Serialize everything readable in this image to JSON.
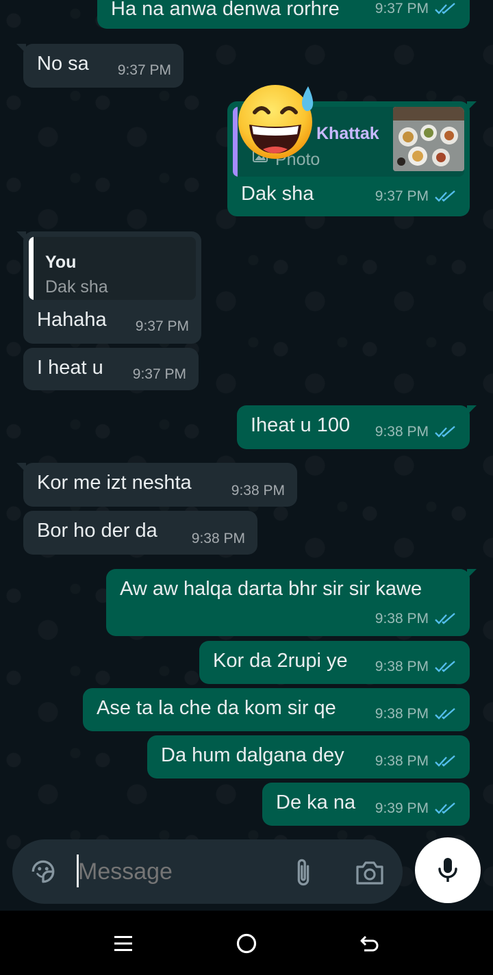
{
  "messages": [
    {
      "direction": "out",
      "text": "Ha na anwa denwa rorhre",
      "time": "9:37 PM"
    },
    {
      "direction": "in",
      "text": "No sa",
      "time": "9:37 PM"
    },
    {
      "direction": "out",
      "text": "Dak sha",
      "time": "9:37 PM",
      "reply_to": {
        "author": "Khattak",
        "preview": "Photo",
        "thumbnail": "food-photo"
      }
    },
    {
      "direction": "in",
      "text": "Hahaha",
      "time": "9:37 PM",
      "reply_to": {
        "author": "You",
        "preview": "Dak sha"
      }
    },
    {
      "direction": "in",
      "text": "I heat u",
      "time": "9:37 PM"
    },
    {
      "direction": "out",
      "text": "Iheat u 100",
      "time": "9:38 PM"
    },
    {
      "direction": "in",
      "text": "Kor me izt neshta",
      "time": "9:38 PM"
    },
    {
      "direction": "in",
      "text": "Bor ho der da",
      "time": "9:38 PM"
    },
    {
      "direction": "out",
      "text": "Aw aw halqa darta bhr sir sir kawe",
      "time": "9:38 PM"
    },
    {
      "direction": "out",
      "text": "Kor da 2rupi ye",
      "time": "9:38 PM"
    },
    {
      "direction": "out",
      "text": "Ase ta la che da kom sir qe",
      "time": "9:38 PM"
    },
    {
      "direction": "out",
      "text": "Da hum dalgana dey",
      "time": "9:38 PM"
    },
    {
      "direction": "out",
      "text": "De ka na",
      "time": "9:39 PM"
    }
  ],
  "reaction_emoji": "grinning-face-with-sweat",
  "composer": {
    "placeholder": "Message",
    "icons": [
      "sticker-icon",
      "attach-icon",
      "camera-icon"
    ],
    "send_icon": "mic-icon"
  },
  "navbar": {
    "icons": [
      "recents-icon",
      "home-icon",
      "back-icon"
    ]
  },
  "colors": {
    "background": "#0b141a",
    "incoming_bubble": "#202c33",
    "outgoing_bubble": "#005c4b",
    "read_ticks": "#53bdeb",
    "quote_bar_you": "#ffffff",
    "quote_bar_khattak": "#a58cff",
    "quote_author_khattak": "#c8b9ff"
  }
}
